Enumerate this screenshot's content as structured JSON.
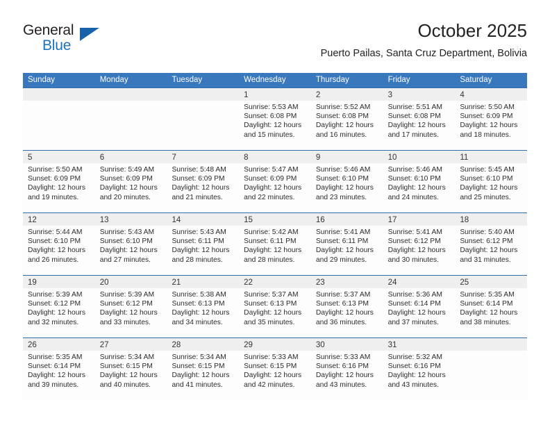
{
  "logo": {
    "word_one": "General",
    "word_two": "Blue",
    "triangle_color": "#1762ab",
    "blue_color": "#1a73c4"
  },
  "header": {
    "title": "October 2025",
    "subtitle": "Puerto Pailas, Santa Cruz Department, Bolivia"
  },
  "colors": {
    "header_blue": "#3a78bd",
    "row_border_blue": "#2e6da8",
    "day_strip_gray": "#efefef"
  },
  "weekdays": [
    "Sunday",
    "Monday",
    "Tuesday",
    "Wednesday",
    "Thursday",
    "Friday",
    "Saturday"
  ],
  "weeks": [
    [
      {
        "day": "",
        "lines": []
      },
      {
        "day": "",
        "lines": []
      },
      {
        "day": "",
        "lines": []
      },
      {
        "day": "1",
        "lines": [
          "Sunrise: 5:53 AM",
          "Sunset: 6:08 PM",
          "Daylight: 12 hours",
          "and 15 minutes."
        ]
      },
      {
        "day": "2",
        "lines": [
          "Sunrise: 5:52 AM",
          "Sunset: 6:08 PM",
          "Daylight: 12 hours",
          "and 16 minutes."
        ]
      },
      {
        "day": "3",
        "lines": [
          "Sunrise: 5:51 AM",
          "Sunset: 6:08 PM",
          "Daylight: 12 hours",
          "and 17 minutes."
        ]
      },
      {
        "day": "4",
        "lines": [
          "Sunrise: 5:50 AM",
          "Sunset: 6:09 PM",
          "Daylight: 12 hours",
          "and 18 minutes."
        ]
      }
    ],
    [
      {
        "day": "5",
        "lines": [
          "Sunrise: 5:50 AM",
          "Sunset: 6:09 PM",
          "Daylight: 12 hours",
          "and 19 minutes."
        ]
      },
      {
        "day": "6",
        "lines": [
          "Sunrise: 5:49 AM",
          "Sunset: 6:09 PM",
          "Daylight: 12 hours",
          "and 20 minutes."
        ]
      },
      {
        "day": "7",
        "lines": [
          "Sunrise: 5:48 AM",
          "Sunset: 6:09 PM",
          "Daylight: 12 hours",
          "and 21 minutes."
        ]
      },
      {
        "day": "8",
        "lines": [
          "Sunrise: 5:47 AM",
          "Sunset: 6:09 PM",
          "Daylight: 12 hours",
          "and 22 minutes."
        ]
      },
      {
        "day": "9",
        "lines": [
          "Sunrise: 5:46 AM",
          "Sunset: 6:10 PM",
          "Daylight: 12 hours",
          "and 23 minutes."
        ]
      },
      {
        "day": "10",
        "lines": [
          "Sunrise: 5:46 AM",
          "Sunset: 6:10 PM",
          "Daylight: 12 hours",
          "and 24 minutes."
        ]
      },
      {
        "day": "11",
        "lines": [
          "Sunrise: 5:45 AM",
          "Sunset: 6:10 PM",
          "Daylight: 12 hours",
          "and 25 minutes."
        ]
      }
    ],
    [
      {
        "day": "12",
        "lines": [
          "Sunrise: 5:44 AM",
          "Sunset: 6:10 PM",
          "Daylight: 12 hours",
          "and 26 minutes."
        ]
      },
      {
        "day": "13",
        "lines": [
          "Sunrise: 5:43 AM",
          "Sunset: 6:10 PM",
          "Daylight: 12 hours",
          "and 27 minutes."
        ]
      },
      {
        "day": "14",
        "lines": [
          "Sunrise: 5:43 AM",
          "Sunset: 6:11 PM",
          "Daylight: 12 hours",
          "and 28 minutes."
        ]
      },
      {
        "day": "15",
        "lines": [
          "Sunrise: 5:42 AM",
          "Sunset: 6:11 PM",
          "Daylight: 12 hours",
          "and 28 minutes."
        ]
      },
      {
        "day": "16",
        "lines": [
          "Sunrise: 5:41 AM",
          "Sunset: 6:11 PM",
          "Daylight: 12 hours",
          "and 29 minutes."
        ]
      },
      {
        "day": "17",
        "lines": [
          "Sunrise: 5:41 AM",
          "Sunset: 6:12 PM",
          "Daylight: 12 hours",
          "and 30 minutes."
        ]
      },
      {
        "day": "18",
        "lines": [
          "Sunrise: 5:40 AM",
          "Sunset: 6:12 PM",
          "Daylight: 12 hours",
          "and 31 minutes."
        ]
      }
    ],
    [
      {
        "day": "19",
        "lines": [
          "Sunrise: 5:39 AM",
          "Sunset: 6:12 PM",
          "Daylight: 12 hours",
          "and 32 minutes."
        ]
      },
      {
        "day": "20",
        "lines": [
          "Sunrise: 5:39 AM",
          "Sunset: 6:12 PM",
          "Daylight: 12 hours",
          "and 33 minutes."
        ]
      },
      {
        "day": "21",
        "lines": [
          "Sunrise: 5:38 AM",
          "Sunset: 6:13 PM",
          "Daylight: 12 hours",
          "and 34 minutes."
        ]
      },
      {
        "day": "22",
        "lines": [
          "Sunrise: 5:37 AM",
          "Sunset: 6:13 PM",
          "Daylight: 12 hours",
          "and 35 minutes."
        ]
      },
      {
        "day": "23",
        "lines": [
          "Sunrise: 5:37 AM",
          "Sunset: 6:13 PM",
          "Daylight: 12 hours",
          "and 36 minutes."
        ]
      },
      {
        "day": "24",
        "lines": [
          "Sunrise: 5:36 AM",
          "Sunset: 6:14 PM",
          "Daylight: 12 hours",
          "and 37 minutes."
        ]
      },
      {
        "day": "25",
        "lines": [
          "Sunrise: 5:35 AM",
          "Sunset: 6:14 PM",
          "Daylight: 12 hours",
          "and 38 minutes."
        ]
      }
    ],
    [
      {
        "day": "26",
        "lines": [
          "Sunrise: 5:35 AM",
          "Sunset: 6:14 PM",
          "Daylight: 12 hours",
          "and 39 minutes."
        ]
      },
      {
        "day": "27",
        "lines": [
          "Sunrise: 5:34 AM",
          "Sunset: 6:15 PM",
          "Daylight: 12 hours",
          "and 40 minutes."
        ]
      },
      {
        "day": "28",
        "lines": [
          "Sunrise: 5:34 AM",
          "Sunset: 6:15 PM",
          "Daylight: 12 hours",
          "and 41 minutes."
        ]
      },
      {
        "day": "29",
        "lines": [
          "Sunrise: 5:33 AM",
          "Sunset: 6:15 PM",
          "Daylight: 12 hours",
          "and 42 minutes."
        ]
      },
      {
        "day": "30",
        "lines": [
          "Sunrise: 5:33 AM",
          "Sunset: 6:16 PM",
          "Daylight: 12 hours",
          "and 43 minutes."
        ]
      },
      {
        "day": "31",
        "lines": [
          "Sunrise: 5:32 AM",
          "Sunset: 6:16 PM",
          "Daylight: 12 hours",
          "and 43 minutes."
        ]
      },
      {
        "day": "",
        "lines": []
      }
    ]
  ]
}
